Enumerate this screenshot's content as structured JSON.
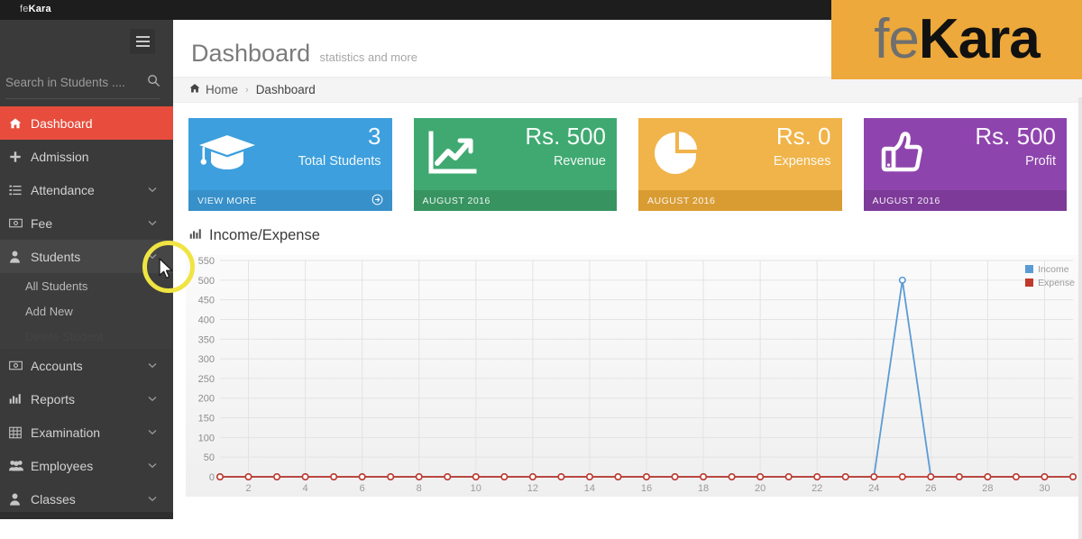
{
  "topbar": {
    "brand_light": "fe",
    "brand_bold": "Kara"
  },
  "logo_overlay": {
    "part1": "fe",
    "part2": "Kara",
    "bg": "#eda93b"
  },
  "sidebar": {
    "search": {
      "value": "",
      "placeholder": "Search in Students ....",
      "icon": "search-icon"
    },
    "hamburger_icon": "hamburger-icon",
    "items": [
      {
        "label": "Dashboard",
        "icon": "home-icon",
        "active": true,
        "caret": false
      },
      {
        "label": "Admission",
        "icon": "plus-icon",
        "active": false,
        "caret": false
      },
      {
        "label": "Attendance",
        "icon": "list-icon",
        "active": false,
        "caret": true
      },
      {
        "label": "Fee",
        "icon": "money-icon",
        "active": false,
        "caret": true
      },
      {
        "label": "Students",
        "icon": "user-icon",
        "active": false,
        "caret": true,
        "open": true
      },
      {
        "label": "Accounts",
        "icon": "money-icon",
        "active": false,
        "caret": true
      },
      {
        "label": "Reports",
        "icon": "bar-chart-icon",
        "active": false,
        "caret": true
      },
      {
        "label": "Examination",
        "icon": "table-icon",
        "active": false,
        "caret": true
      },
      {
        "label": "Employees",
        "icon": "users-icon",
        "active": false,
        "caret": true
      },
      {
        "label": "Classes",
        "icon": "user-icon",
        "active": false,
        "caret": true
      }
    ],
    "students_submenu": [
      {
        "label": "All Students",
        "faded": false
      },
      {
        "label": "Add New",
        "faded": false
      },
      {
        "label": "Delete Student",
        "faded": true
      }
    ]
  },
  "header": {
    "title": "Dashboard",
    "subtitle": "statistics and more",
    "breadcrumb": {
      "home_icon": "home-icon",
      "home": "Home",
      "separator": "›",
      "current": "Dashboard"
    }
  },
  "cards": [
    {
      "value": "3",
      "caption": "Total Students",
      "footer": "VIEW MORE",
      "color": "#3d9fdd",
      "theme": "blue",
      "icon": "graduation-cap-icon",
      "has_arrow": true
    },
    {
      "value": "Rs. 500",
      "caption": "Revenue",
      "footer": "AUGUST 2016",
      "color": "#3fa971",
      "theme": "green",
      "icon": "line-chart-up-icon",
      "has_arrow": false
    },
    {
      "value": "Rs. 0",
      "caption": "Expenses",
      "footer": "AUGUST 2016",
      "color": "#f0b44a",
      "theme": "yellow",
      "icon": "pie-chart-icon",
      "has_arrow": false
    },
    {
      "value": "Rs. 500",
      "caption": "Profit",
      "footer": "AUGUST 2016",
      "color": "#8e44ad",
      "theme": "purple",
      "icon": "thumbs-up-icon",
      "has_arrow": false
    }
  ],
  "chart_panel": {
    "title": "Income/Expense",
    "title_icon": "bar-chart-icon"
  },
  "chart_data": {
    "type": "line",
    "title": "Income/Expense",
    "xlabel": "",
    "ylabel": "",
    "ylim": [
      0,
      550
    ],
    "yticks": [
      0,
      50,
      100,
      150,
      200,
      250,
      300,
      350,
      400,
      450,
      500,
      550
    ],
    "grid": true,
    "legend_position": "top-right",
    "x": [
      1,
      2,
      3,
      4,
      5,
      6,
      7,
      8,
      9,
      10,
      11,
      12,
      13,
      14,
      15,
      16,
      17,
      18,
      19,
      20,
      21,
      22,
      23,
      24,
      25,
      26,
      27,
      28,
      29,
      30,
      31
    ],
    "xticks_labeled": [
      2,
      4,
      6,
      8,
      10,
      12,
      14,
      16,
      18,
      20,
      22,
      24,
      26,
      28,
      30
    ],
    "series": [
      {
        "name": "Income",
        "color": "#5b9bd5",
        "values": [
          0,
          0,
          0,
          0,
          0,
          0,
          0,
          0,
          0,
          0,
          0,
          0,
          0,
          0,
          0,
          0,
          0,
          0,
          0,
          0,
          0,
          0,
          0,
          0,
          500,
          0,
          0,
          0,
          0,
          0,
          0
        ]
      },
      {
        "name": "Expense",
        "color": "#c0392b",
        "values": [
          0,
          0,
          0,
          0,
          0,
          0,
          0,
          0,
          0,
          0,
          0,
          0,
          0,
          0,
          0,
          0,
          0,
          0,
          0,
          0,
          0,
          0,
          0,
          0,
          0,
          0,
          0,
          0,
          0,
          0,
          0
        ]
      }
    ]
  },
  "annotation": {
    "circle_color": "#f0e442",
    "cursor_icon": "mouse-cursor-icon"
  }
}
